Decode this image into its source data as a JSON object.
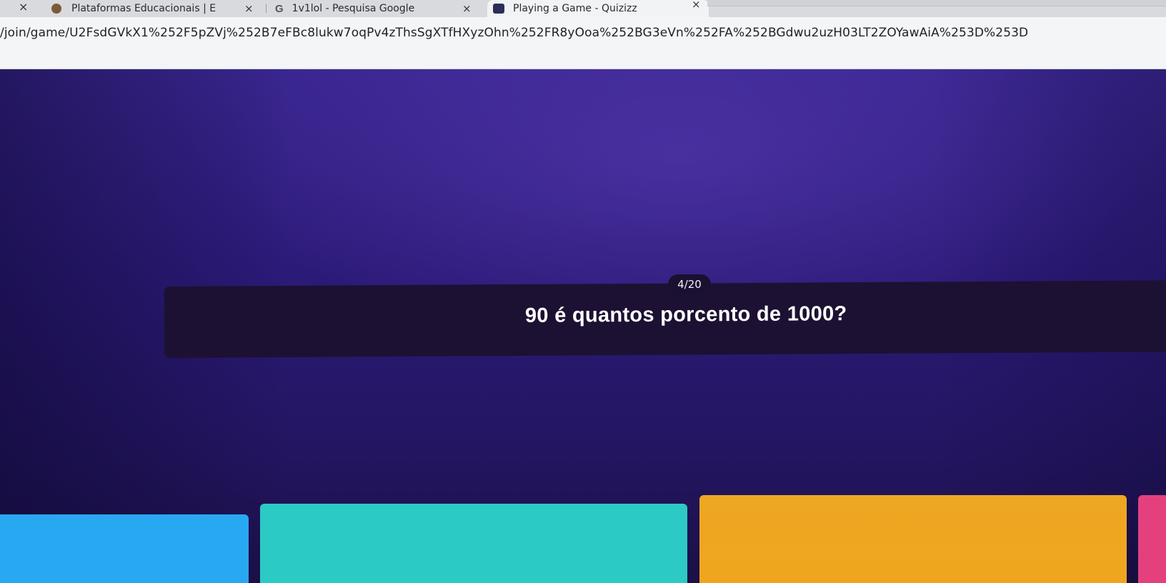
{
  "browser": {
    "tabs": [
      {
        "label": "Plataformas Educacionais | E",
        "icon": "school-crest-icon"
      },
      {
        "label": "1v1lol - Pesquisa Google",
        "icon": "google-g-icon"
      },
      {
        "label": "Playing a Game - Quizizz",
        "icon": "quizizz-icon"
      }
    ],
    "close_glyph": "×",
    "url": "/join/game/U2FsdGVkX1%252F5pZVj%252B7eFBc8lukw7oqPv4zThsSgXTfHXyzOhn%252FR8yOoa%252BG3eVn%252FA%252BGdwu2uzH03LT2ZOYawAiA%253D%253D"
  },
  "quiz": {
    "counter": "4/20",
    "question": "90 é quantos porcento de 1000?",
    "option_colors": [
      "#29a8f2",
      "#2ccac4",
      "#eda723",
      "#e4407e"
    ]
  }
}
